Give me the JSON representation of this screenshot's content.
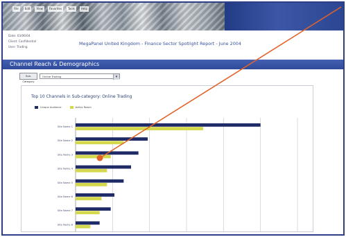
{
  "window": {
    "menu_items": [
      "File",
      "Edit",
      "View",
      "Favorites",
      "Tools",
      "Help"
    ],
    "info_lines": [
      "Date: 03/06/04",
      "Client: Confidential",
      "User: Trading"
    ],
    "report_title": "MegaPanel United Kingdom - Finance Sector Spotlight Report - June 2004"
  },
  "section": {
    "title": "Channel Reach & Demographics"
  },
  "filter": {
    "button_label": "Sub-Category",
    "selected_value": "Online Trading"
  },
  "chart_data": {
    "type": "bar",
    "title": "Top 10 Channels in Sub-category: Online Trading",
    "categories": [
      "Site Name 1",
      "Site Name 2",
      "Site Name 3",
      "Site Name 4",
      "Site Name 5",
      "Site Name 6",
      "Site Name 7",
      "Site Name 8",
      "Site Name 9"
    ],
    "series": [
      {
        "name": "Unique Audience",
        "color": "#1f2b66",
        "values": [
          100,
          39,
          34,
          30,
          26,
          21,
          19,
          13,
          11
        ]
      },
      {
        "name": "Active Reach",
        "color": "#d4d84d",
        "values": [
          69,
          26,
          19,
          17,
          17,
          14,
          13,
          8,
          7
        ]
      }
    ],
    "ylim": [
      0,
      120
    ],
    "grid": true,
    "legend": "top-left"
  },
  "colors": {
    "banner_blue": "#2b4692",
    "pointer": "#e1632a"
  }
}
